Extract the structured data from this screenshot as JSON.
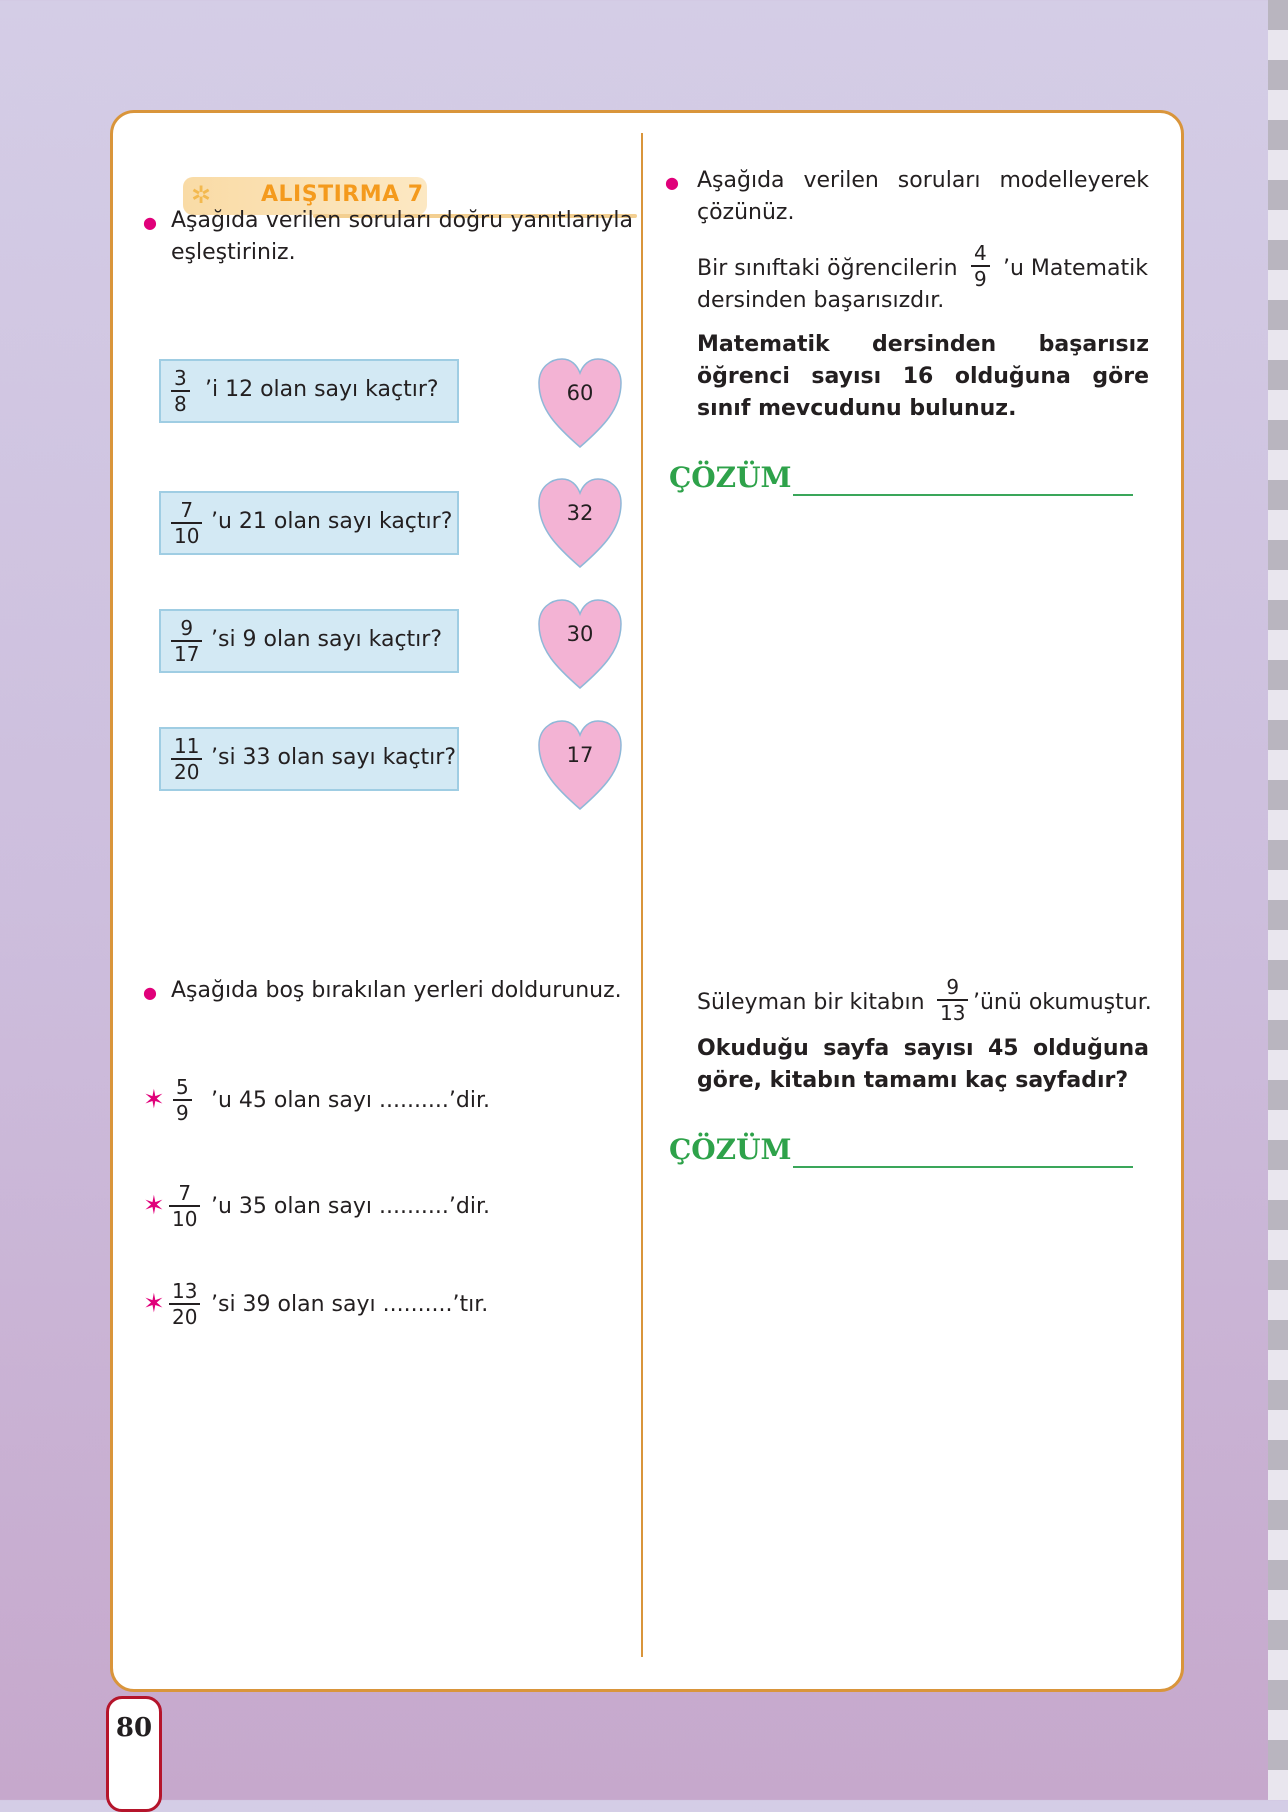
{
  "exercise": {
    "title": "ALIŞTIRMA 7"
  },
  "left": {
    "instruction1": "Aşağıda verilen soruları doğru yanıtlarıyla eşleştiriniz.",
    "questions": [
      {
        "num": "3",
        "den": "8",
        "text": "’i 12 olan sayı kaçtır?"
      },
      {
        "num": "7",
        "den": "10",
        "text": "’u 21 olan sayı kaçtır?"
      },
      {
        "num": "9",
        "den": "17",
        "text": "’si 9 olan sayı kaçtır?"
      },
      {
        "num": "11",
        "den": "20",
        "text": "’si 33 olan sayı kaçtır?"
      }
    ],
    "answers": [
      "60",
      "32",
      "30",
      "17"
    ],
    "instruction2": "Aşağıda boş bırakılan yerleri doldurunuz.",
    "fills": [
      {
        "num": "5",
        "den": "9",
        "text": "’u 45 olan sayı ..........’dir."
      },
      {
        "num": "7",
        "den": "10",
        "text": "’u 35 olan sayı ..........’dir."
      },
      {
        "num": "13",
        "den": "20",
        "text": "’si 39 olan sayı ..........’tır."
      }
    ]
  },
  "right": {
    "instruction": "Aşağıda verilen soruları modelleyerek çözünüz.",
    "problem1": {
      "pre": "Bir sınıftaki öğrencilerin",
      "num": "4",
      "den": "9",
      "post": "’u Matematik",
      "line2": "dersinden başarısızdır.",
      "question": "Matematik dersinden başarısız öğrenci sayısı 16 olduğuna göre sınıf mevcudunu bulunuz."
    },
    "problem2": {
      "pre": "Süleyman bir kitabın",
      "num": "9",
      "den": "13",
      "post": "’ünü okumuştur.",
      "question": "Okuduğu sayfa sayısı 45 olduğuna göre, kitabın tamamı kaç sayfadır?"
    },
    "solution_label": "ÇÖZÜM"
  },
  "page_number": "80",
  "colors": {
    "frame": "#d9953b",
    "question_box": "#d3e9f4",
    "heart": "#f3b3d4",
    "bullet": "#e0007a",
    "title": "#f49a1d",
    "solution": "#2ea24a"
  }
}
